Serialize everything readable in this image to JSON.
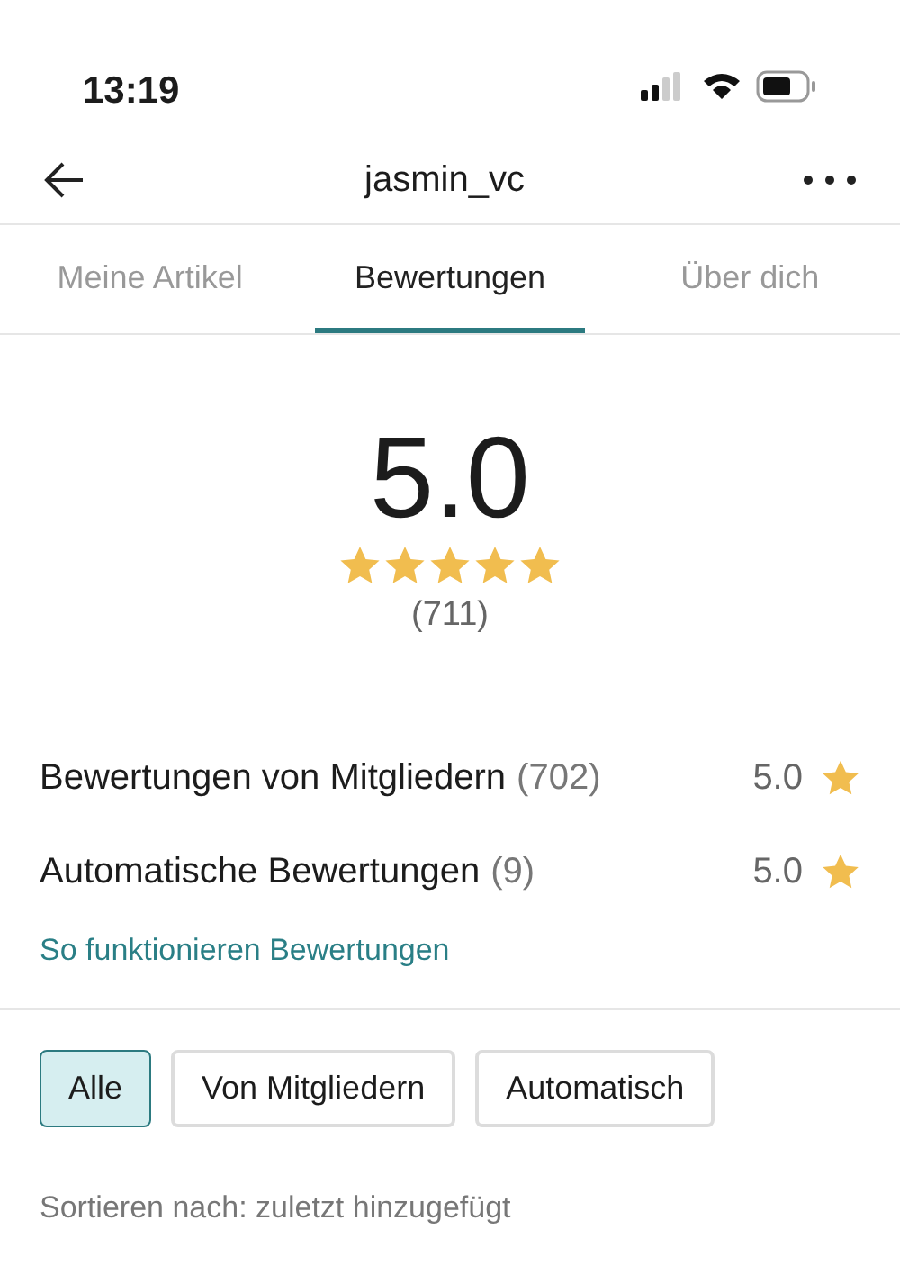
{
  "status_bar": {
    "time": "13:19"
  },
  "header": {
    "title": "jasmin_vc"
  },
  "tabs": [
    {
      "label": "Meine Artikel",
      "selected": false
    },
    {
      "label": "Bewertungen",
      "selected": true
    },
    {
      "label": "Über dich",
      "selected": false
    }
  ],
  "summary": {
    "score": "5.0",
    "stars": 5,
    "count": "(711)"
  },
  "breakdown": [
    {
      "label": "Bewertungen von Mitgliedern",
      "count": "(702)",
      "score": "5.0"
    },
    {
      "label": "Automatische Bewertungen",
      "count": "(9)",
      "score": "5.0"
    }
  ],
  "help_link": "So funktionieren Bewertungen",
  "filters": [
    {
      "label": "Alle",
      "selected": true
    },
    {
      "label": "Von Mitgliedern",
      "selected": false
    },
    {
      "label": "Automatisch",
      "selected": false
    }
  ],
  "sort_label": "Sortieren nach: zuletzt hinzugefügt"
}
